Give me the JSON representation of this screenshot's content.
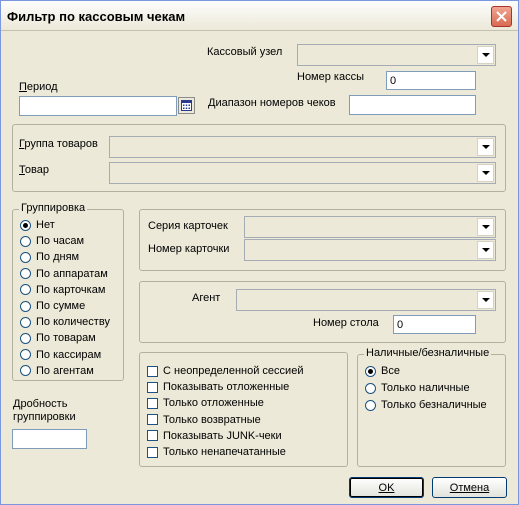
{
  "window": {
    "title": "Фильтр по кассовым чекам"
  },
  "header": {
    "cash_node_label": "Кассовый узел",
    "cash_number_label": "Номер кассы",
    "cash_number_value": "0",
    "period_label": "Период",
    "period_value": "",
    "receipt_range_label": "Диапазон номеров чеков",
    "receipt_range_value": ""
  },
  "goods": {
    "group_label": "Группа товаров",
    "item_label": "Товар"
  },
  "grouping": {
    "legend": "Группировка",
    "options": [
      "Нет",
      "По часам",
      "По дням",
      "По аппаратам",
      "По карточкам",
      "По сумме",
      "По количеству",
      "По товарам",
      "По кассирам",
      "По агентам"
    ],
    "selected": "Нет",
    "fraction_label_1": "Дробность",
    "fraction_label_2": "группировки",
    "fraction_value": ""
  },
  "card": {
    "series_label": "Серия карточек",
    "number_label": "Номер карточки"
  },
  "agent": {
    "agent_label": "Агент",
    "table_label": "Номер стола",
    "table_value": "0"
  },
  "flags": {
    "items": [
      "С неопределенной сессией",
      "Показывать отложенные",
      "Только отложенные",
      "Только возвратные",
      "Показывать JUNK-чеки",
      "Только ненапечатанные"
    ]
  },
  "payment": {
    "legend": "Наличные/безналичные",
    "options": [
      "Все",
      "Только наличные",
      "Только безналичные"
    ],
    "selected": "Все"
  },
  "buttons": {
    "ok": "OK",
    "cancel": "Отмена"
  }
}
